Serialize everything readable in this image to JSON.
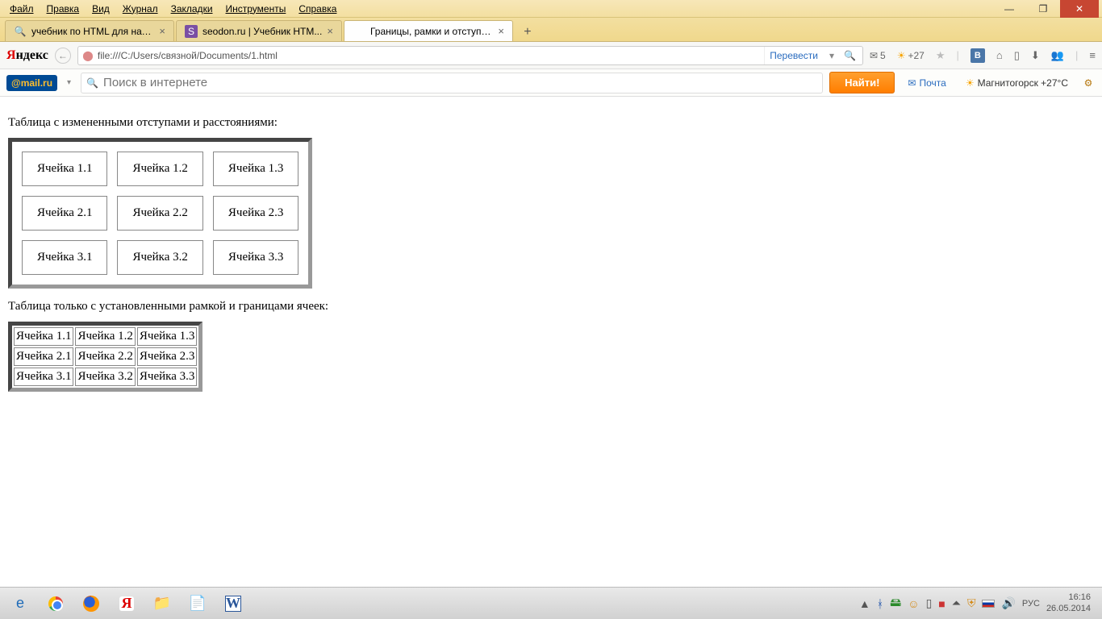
{
  "menubar": {
    "file": "Файл",
    "edit": "Правка",
    "view": "Вид",
    "history": "Журнал",
    "bookmarks": "Закладки",
    "tools": "Инструменты",
    "help": "Справка"
  },
  "window_controls": {
    "minimize": "—",
    "maximize": "❐",
    "close": "✕"
  },
  "tabs": [
    {
      "title": "учебник по HTML для начи...",
      "favicon": "🔍"
    },
    {
      "title": "seodon.ru | Учебник HTM...",
      "favicon": "S"
    },
    {
      "title": "Границы, рамки и отступы та...",
      "favicon": ""
    }
  ],
  "new_tab": "+",
  "yandex_logo": {
    "ya": "Я",
    "ndex": "ндекс"
  },
  "nav_back": "←",
  "url": {
    "icon": "⬤",
    "value": "file:///C:/Users/связной/Documents/1.html",
    "translate": "Перевести",
    "dropdown": "▾",
    "search": "🔍"
  },
  "toolbar": {
    "mail_count": "5",
    "mail_icon": "✉",
    "weather_icon": "☀",
    "weather_temp": "+27",
    "star": "★",
    "vk": "B",
    "dl": "⬇",
    "home": "⌂",
    "friends": "👥",
    "menu": "≡",
    "reading": "▯"
  },
  "mailru": {
    "logo": "@mail.ru",
    "dropdown": "▾",
    "search_icon": "🔍",
    "placeholder": "Поиск в интернете",
    "find": "Найти!",
    "mail": "Почта",
    "mail_icon": "✉",
    "weather_city": "Магнитогорск +27°C",
    "weather_icon": "☀",
    "settings": "⚙"
  },
  "content": {
    "caption1": "Таблица с измененными отступами и расстояниями:",
    "caption2": "Таблица только с установленными рамкой и границами ячеек:",
    "table1": [
      [
        "Ячейка 1.1",
        "Ячейка 1.2",
        "Ячейка 1.3"
      ],
      [
        "Ячейка 2.1",
        "Ячейка 2.2",
        "Ячейка 2.3"
      ],
      [
        "Ячейка 3.1",
        "Ячейка 3.2",
        "Ячейка 3.3"
      ]
    ],
    "table2": [
      [
        "Ячейка 1.1",
        "Ячейка 1.2",
        "Ячейка 1.3"
      ],
      [
        "Ячейка 2.1",
        "Ячейка 2.2",
        "Ячейка 2.3"
      ],
      [
        "Ячейка 3.1",
        "Ячейка 3.2",
        "Ячейка 3.3"
      ]
    ]
  },
  "taskbar": {
    "ie": "e",
    "yandex_y": "Я",
    "word_w": "W",
    "notes": "📄",
    "explorer": "📁"
  },
  "tray": {
    "up": "▲",
    "bt": "ᚼ",
    "disk1": "🖴",
    "smiley": "☺",
    "battery": "▯",
    "net": "■",
    "wifi": "⏶",
    "flag": "",
    "vol": "🔊",
    "shield": "⛨",
    "lang": "РУС",
    "time": "16:16",
    "date": "26.05.2014"
  }
}
